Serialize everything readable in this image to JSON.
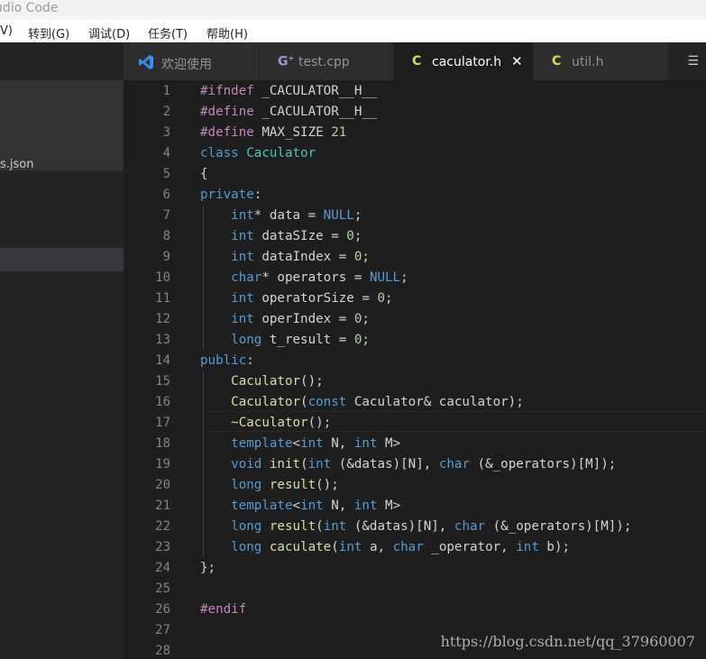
{
  "window": {
    "title": "udio Code"
  },
  "menu": [
    {
      "label": "V)"
    },
    {
      "label": "转到(G)"
    },
    {
      "label": "调试(D)"
    },
    {
      "label": "任务(T)"
    },
    {
      "label": "帮助(H)"
    }
  ],
  "sidebar": {
    "item_label": "s.json"
  },
  "tabs": [
    {
      "label": "欢迎使用",
      "icon": "vscode-icon",
      "color": "#3b8eea"
    },
    {
      "label": "test.cpp",
      "icon": "cpp-icon",
      "color": "#9b9bd8"
    },
    {
      "label": "caculator.h",
      "icon": "c-icon",
      "color": "#dcdc5a",
      "active": true
    },
    {
      "label": "util.h",
      "icon": "c-icon",
      "color": "#dcdc5a"
    }
  ],
  "editor": {
    "line_numbers": [
      "1",
      "2",
      "3",
      "4",
      "5",
      "6",
      "7",
      "8",
      "9",
      "10",
      "11",
      "12",
      "13",
      "14",
      "15",
      "16",
      "17",
      "18",
      "19",
      "20",
      "21",
      "22",
      "23",
      "24",
      "25",
      "26",
      "27",
      "28"
    ],
    "lines": [
      [
        [
          "pp",
          "#ifndef"
        ],
        [
          "id",
          " _CACULATOR__H__"
        ]
      ],
      [
        [
          "pp",
          "#define"
        ],
        [
          "id",
          " _CACULATOR__H__"
        ]
      ],
      [
        [
          "pp",
          "#define"
        ],
        [
          "id",
          " MAX_SIZE "
        ],
        [
          "num",
          "21"
        ]
      ],
      [
        [
          "kw",
          "class"
        ],
        [
          "id",
          " "
        ],
        [
          "cls",
          "Caculator"
        ]
      ],
      [
        [
          "id",
          "{"
        ]
      ],
      [
        [
          "kw",
          "private"
        ],
        [
          "id",
          ":"
        ]
      ],
      [
        [
          "id",
          "    "
        ],
        [
          "kw",
          "int"
        ],
        [
          "id",
          "* data = "
        ],
        [
          "kw",
          "NULL"
        ],
        [
          "id",
          ";"
        ]
      ],
      [
        [
          "id",
          "    "
        ],
        [
          "kw",
          "int"
        ],
        [
          "id",
          " dataSIze = "
        ],
        [
          "num",
          "0"
        ],
        [
          "id",
          ";"
        ]
      ],
      [
        [
          "id",
          "    "
        ],
        [
          "kw",
          "int"
        ],
        [
          "id",
          " dataIndex = "
        ],
        [
          "num",
          "0"
        ],
        [
          "id",
          ";"
        ]
      ],
      [
        [
          "id",
          "    "
        ],
        [
          "kw",
          "char"
        ],
        [
          "id",
          "* operators = "
        ],
        [
          "kw",
          "NULL"
        ],
        [
          "id",
          ";"
        ]
      ],
      [
        [
          "id",
          "    "
        ],
        [
          "kw",
          "int"
        ],
        [
          "id",
          " operatorSize = "
        ],
        [
          "num",
          "0"
        ],
        [
          "id",
          ";"
        ]
      ],
      [
        [
          "id",
          "    "
        ],
        [
          "kw",
          "int"
        ],
        [
          "id",
          " operIndex = "
        ],
        [
          "num",
          "0"
        ],
        [
          "id",
          ";"
        ]
      ],
      [
        [
          "id",
          "    "
        ],
        [
          "kw",
          "long"
        ],
        [
          "id",
          " t_result = "
        ],
        [
          "num",
          "0"
        ],
        [
          "id",
          ";"
        ]
      ],
      [
        [
          "kw",
          "public"
        ],
        [
          "id",
          ":"
        ]
      ],
      [
        [
          "id",
          "    "
        ],
        [
          "fn",
          "Caculator"
        ],
        [
          "id",
          "();"
        ]
      ],
      [
        [
          "id",
          "    "
        ],
        [
          "fn",
          "Caculator"
        ],
        [
          "id",
          "("
        ],
        [
          "kw",
          "const"
        ],
        [
          "id",
          " Caculator& caculator);"
        ]
      ],
      [
        [
          "id",
          "    ~"
        ],
        [
          "fn",
          "Caculator"
        ],
        [
          "id",
          "();"
        ]
      ],
      [
        [
          "id",
          "    "
        ],
        [
          "kw",
          "template"
        ],
        [
          "id",
          "<"
        ],
        [
          "kw",
          "int"
        ],
        [
          "id",
          " N, "
        ],
        [
          "kw",
          "int"
        ],
        [
          "id",
          " M>"
        ]
      ],
      [
        [
          "id",
          "    "
        ],
        [
          "kw",
          "void"
        ],
        [
          "id",
          " "
        ],
        [
          "fn",
          "init"
        ],
        [
          "id",
          "("
        ],
        [
          "kw",
          "int"
        ],
        [
          "id",
          " (&datas)[N], "
        ],
        [
          "kw",
          "char"
        ],
        [
          "id",
          " (&_operators)[M]);"
        ]
      ],
      [
        [
          "id",
          "    "
        ],
        [
          "kw",
          "long"
        ],
        [
          "id",
          " "
        ],
        [
          "fn",
          "result"
        ],
        [
          "id",
          "();"
        ]
      ],
      [
        [
          "id",
          "    "
        ],
        [
          "kw",
          "template"
        ],
        [
          "id",
          "<"
        ],
        [
          "kw",
          "int"
        ],
        [
          "id",
          " N, "
        ],
        [
          "kw",
          "int"
        ],
        [
          "id",
          " M>"
        ]
      ],
      [
        [
          "id",
          "    "
        ],
        [
          "kw",
          "long"
        ],
        [
          "id",
          " "
        ],
        [
          "fn",
          "result"
        ],
        [
          "id",
          "("
        ],
        [
          "kw",
          "int"
        ],
        [
          "id",
          " (&datas)[N], "
        ],
        [
          "kw",
          "char"
        ],
        [
          "id",
          " (&_operators)[M]);"
        ]
      ],
      [
        [
          "id",
          "    "
        ],
        [
          "kw",
          "long"
        ],
        [
          "id",
          " "
        ],
        [
          "fn",
          "caculate"
        ],
        [
          "id",
          "("
        ],
        [
          "kw",
          "int"
        ],
        [
          "id",
          " a, "
        ],
        [
          "kw",
          "char"
        ],
        [
          "id",
          " _operator, "
        ],
        [
          "kw",
          "int"
        ],
        [
          "id",
          " b);"
        ]
      ],
      [
        [
          "id",
          "};"
        ]
      ],
      [],
      [
        [
          "pp",
          "#endif"
        ]
      ],
      [],
      []
    ]
  },
  "watermark": "https://blog.csdn.net/qq_37960007"
}
